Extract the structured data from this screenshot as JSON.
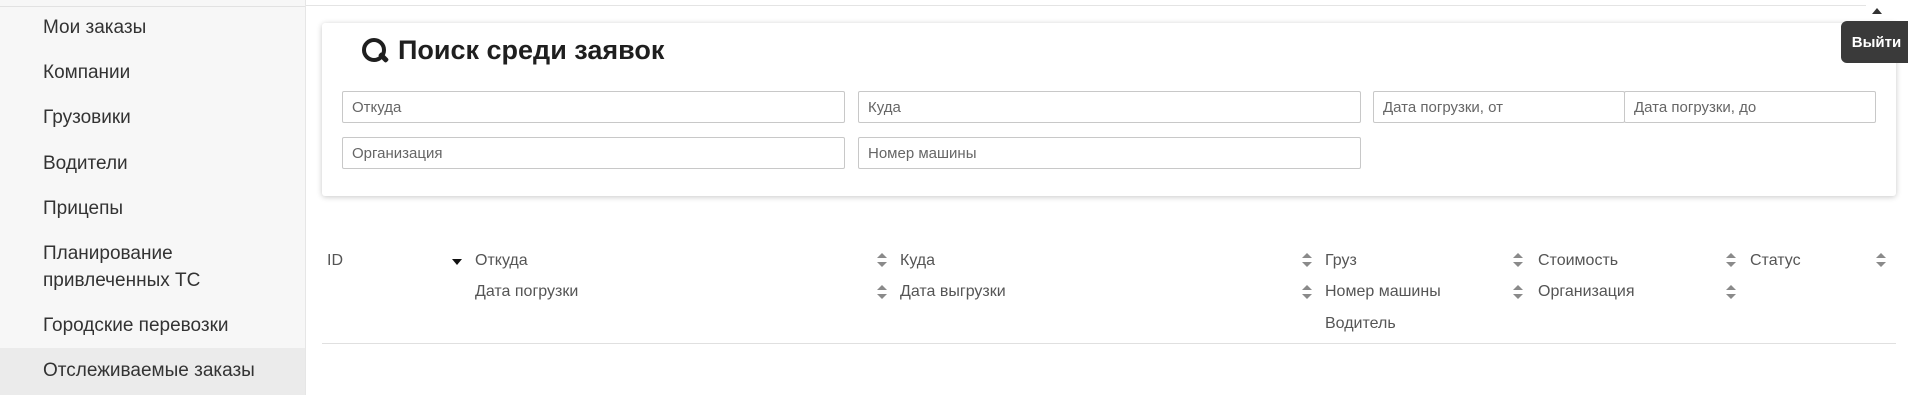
{
  "sidebar": {
    "items": [
      {
        "label": "Мои заказы"
      },
      {
        "label": "Компании"
      },
      {
        "label": "Грузовики"
      },
      {
        "label": "Водители"
      },
      {
        "label": "Прицепы"
      },
      {
        "label": "Планирование привлеченных ТС"
      },
      {
        "label": "Городские перевозки"
      },
      {
        "label": "Отслеживаемые заказы"
      }
    ]
  },
  "search": {
    "title": "Поиск среди заявок",
    "from_placeholder": "Откуда",
    "to_placeholder": "Куда",
    "date_from_placeholder": "Дата погрузки, от",
    "date_to_placeholder": "Дата погрузки, до",
    "org_placeholder": "Организация",
    "car_placeholder": "Номер машины"
  },
  "table": {
    "headers": {
      "id": "ID",
      "from": "Откуда",
      "load_date": "Дата погрузки",
      "to": "Куда",
      "unload_date": "Дата выгрузки",
      "cargo": "Груз",
      "car_number": "Номер машины",
      "driver": "Водитель",
      "cost": "Стоимость",
      "organization": "Организация",
      "status": "Статус"
    }
  },
  "header": {
    "logout_label": "Выйти"
  }
}
